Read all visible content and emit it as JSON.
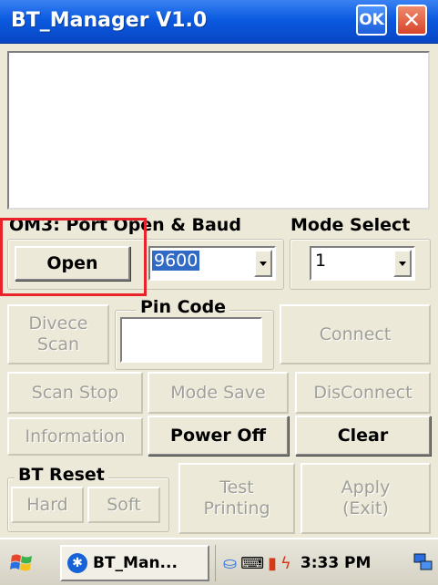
{
  "window": {
    "title": "BT_Manager V1.0",
    "ok_label": "OK",
    "close_label": "✕"
  },
  "log": {
    "text": ""
  },
  "port": {
    "label": "OM3: Port Open & Baud",
    "open_label": "Open",
    "baud_value": "9600"
  },
  "mode": {
    "label": "Mode Select",
    "value": "1"
  },
  "device": {
    "scan_label_line1": "Divece",
    "scan_label_line2": "Scan",
    "pin_label": "Pin Code",
    "pin_value": "",
    "connect_label": "Connect"
  },
  "buttons": {
    "scan_stop": "Scan Stop",
    "mode_save": "Mode Save",
    "disconnect": "DisConnect",
    "information": "Information",
    "power_off": "Power Off",
    "clear": "Clear"
  },
  "bt_reset": {
    "label": "BT Reset",
    "hard": "Hard",
    "soft": "Soft"
  },
  "test_printing": {
    "line1": "Test",
    "line2": "Printing"
  },
  "apply": {
    "line1": "Apply",
    "line2": "(Exit)"
  },
  "taskbar": {
    "start_icon": "windows-flag-icon",
    "task_label": "BT_Man...",
    "clock": "3:33 PM"
  },
  "colors": {
    "titlebar": "#0b5ae0",
    "highlight": "#e8242a",
    "window_bg": "#ece9d8"
  }
}
